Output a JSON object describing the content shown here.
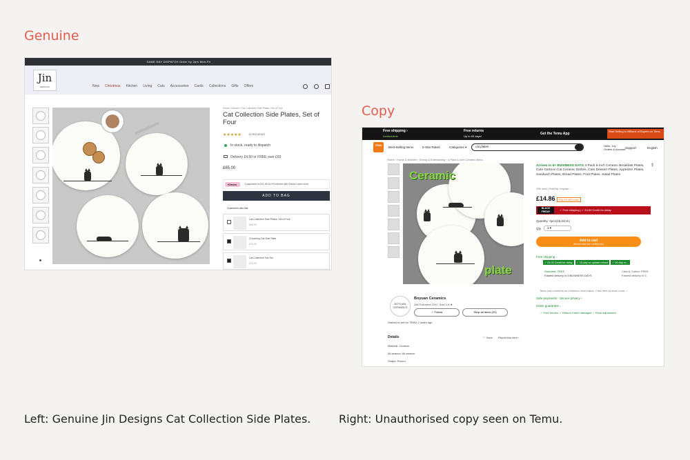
{
  "labels": {
    "genuine": "Genuine",
    "copy": "Copy"
  },
  "captions": {
    "left": "Left: Genuine Jin Designs Cat Collection Side Plates.",
    "right": "Right: Unauthorised copy seen on Temu."
  },
  "genuine": {
    "topbar": "SAME DAY DISPATCH Order by 2pm Mon-Fri",
    "logo_main": "Jin",
    "logo_sub": "DESIGNS",
    "nav": [
      "New",
      "Christmas",
      "Kitchen",
      "Living",
      "Cats",
      "Accessories",
      "Cards",
      "Collections",
      "Gifts",
      "Offers"
    ],
    "breadcrumb": "Home / Kitchen / Cat Collection Side Plates, Set of Four",
    "title": "Cat Collection Side Plates, Set of Four",
    "stars": "★★★★★",
    "reviews": "13 REVIEWS",
    "stock": "In stock, ready to dispatch",
    "delivery": "Delivery £4.50 or FREE over £60",
    "price": "£65.00",
    "klarna_badge": "Klarna.",
    "klarna_text": "3 payments of £21.66 at 0% interest with Klarna  Learn more",
    "add_to_bag": "ADD TO BAG",
    "customers_also_like": "Customers also like",
    "items": [
      {
        "name": "Cat Collection Side Plates, Set of Four",
        "price": "£65.00",
        "checked": false
      },
      {
        "name": "Crouching Cat Side Plate",
        "price": "£20.00",
        "checked": true
      },
      {
        "name": "Cat Collection Tea Set",
        "price": "£75.00",
        "checked": true
      }
    ]
  },
  "copy": {
    "top": {
      "free_shipping": "Free shipping ›",
      "free_shipping_sub": "Limited-time",
      "free_returns": "Free returns",
      "free_returns_sub": "Up to 90 days*",
      "app": "Get the Temu App",
      "promo": "Start Selling to Millions of Buyers on Temu"
    },
    "logo": "TEMU",
    "nav": {
      "best": "Best-Selling Items",
      "five": "5-Star Rated",
      "categories": "Categories ▾"
    },
    "search": "cat plates",
    "account": "Hello, Joy\nOrders & Account",
    "support": "Support",
    "language": "English",
    "breadcrumb": "Home › Home & Kitchen › Dining & Entertaining › 4-Pack 6-inch Ceramic Brea...",
    "overlay_ceramic": "Ceramic",
    "overlay_plate": "plate",
    "arrives_prefix": "Arrives in 5+ BUSINESS DAYS",
    "product_title": "4-Pack 6-inch Ceramic Breakfast Plates, Cute Cartoon Cat Ceramic Dishes, Cute Dessert Plates, Appetizer Plates, Sandwich Plates, Bread Plates, Fruit Plates, Salad Plates",
    "sold": "19K sold | Sold by: boyuan ...",
    "price": "£14.86",
    "save": "Pay £4.68 today",
    "bf_label": "BLACK FRIDAY",
    "bf_text": "✓ Free shipping  |  ✓ £4.00 Credit for delay",
    "quantity_note": "Quantity: 4pcs(15.24cm)",
    "qty_label": "Qty",
    "qty_value": "1  ▾",
    "add_to_cart": "Add to cart",
    "add_to_cart_sub": "Almost sold out • selling fast",
    "free_ship": "Free shipping ›",
    "green_tags": [
      "✓ £4.00 Credit for delay",
      "✓ 15-day no update refund",
      "✓ 90-day re..."
    ],
    "standard": "Standard: FREE",
    "standard_sub": "Fastest delivery in 5 BUSINESS DAYS",
    "click_collect": "Click & Collect: FREE",
    "click_collect_sub": "Fastest delivery in 5",
    "temu_note": "Temu has concerns on minimum order value. Click here to learn more. ›",
    "safe": "Safe payments · Secure privacy ›",
    "order": "Order guarantee ›",
    "checks": "✓ Free returns   ✓ Refund if item damaged   ✓ Price adjustment",
    "store_logo": "BOYUAN CERAMICS",
    "store_name": "Boyuan Ceramics",
    "store_stats": "288 Followers   22K+ Sold   4.8 ★",
    "follow": "☆ Follow",
    "shop_all": "Shop all items (20)",
    "started": "Started to sell on TEMU 2 years ago",
    "details": "Details",
    "save_link": "♡ Save",
    "report": "Report this item ›",
    "material": "Material: Ceramic",
    "season": "All-season: All-season",
    "shape": "Shape: Round"
  }
}
